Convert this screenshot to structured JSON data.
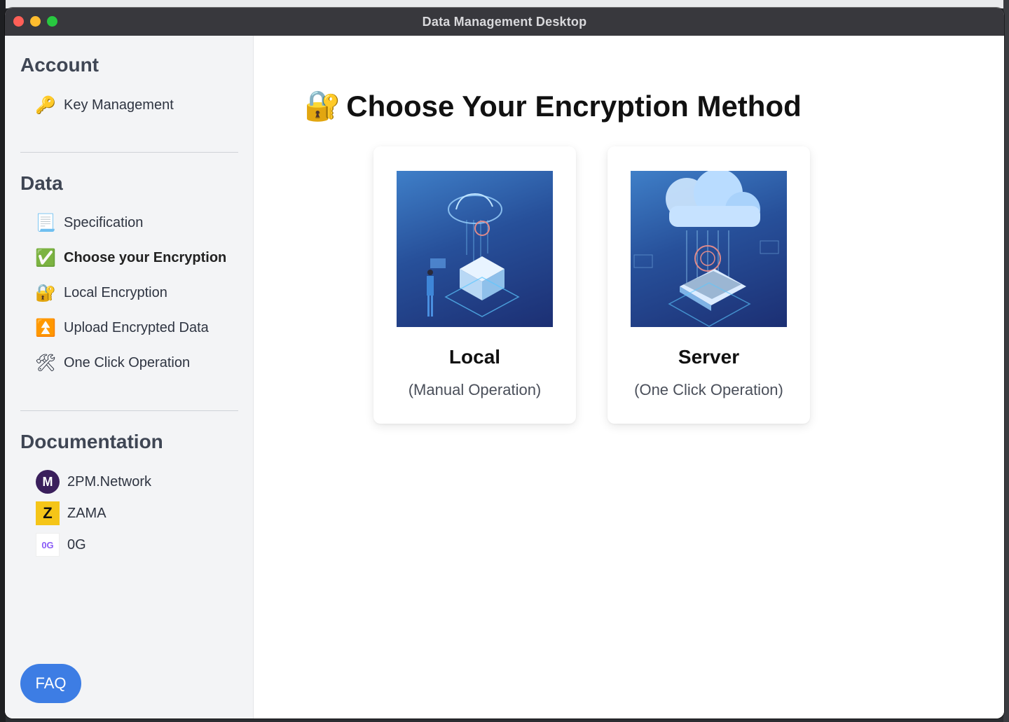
{
  "window": {
    "title": "Data Management Desktop"
  },
  "sidebar": {
    "sections": [
      {
        "title": "Account"
      },
      {
        "title": "Data"
      },
      {
        "title": "Documentation"
      }
    ],
    "account_items": [
      {
        "label": "Key Management",
        "icon": "key-icon",
        "glyph": "🔑"
      }
    ],
    "data_items": [
      {
        "label": "Specification",
        "icon": "scroll-icon",
        "glyph": "📃"
      },
      {
        "label": "Choose your Encryption",
        "icon": "check-icon",
        "glyph": "✅",
        "active": true
      },
      {
        "label": "Local Encryption",
        "icon": "lock-key-icon",
        "glyph": "🔐"
      },
      {
        "label": "Upload Encrypted Data",
        "icon": "upload-icon",
        "glyph": "⏫"
      },
      {
        "label": "One Click Operation",
        "icon": "tools-icon",
        "glyph": "🛠"
      }
    ],
    "doc_items": [
      {
        "label": "2PM.Network",
        "icon": "2pm-logo"
      },
      {
        "label": "ZAMA",
        "icon": "zama-logo"
      },
      {
        "label": "0G",
        "icon": "0g-logo"
      }
    ],
    "faq_label": "FAQ"
  },
  "main": {
    "title": "Choose Your Encryption Method",
    "title_icon": "🔐",
    "cards": [
      {
        "title": "Local",
        "subtitle": "(Manual Operation)",
        "image": "local-illustration"
      },
      {
        "title": "Server",
        "subtitle": "(One Click Operation)",
        "image": "server-illustration"
      }
    ]
  },
  "colors": {
    "accent": "#3d7de4",
    "sidebar_bg": "#f3f4f6",
    "titlebar_bg": "#38383d"
  }
}
